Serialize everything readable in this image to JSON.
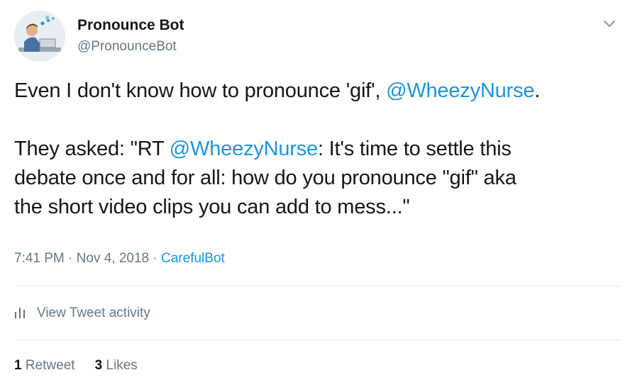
{
  "user": {
    "name": "Pronounce Bot",
    "handle": "@PronounceBot",
    "avatar_icon": "person-at-desk-avatar"
  },
  "menu": {
    "icon": "chevron-down-icon"
  },
  "tweet": {
    "line1_prefix": "Even I don't know how to pronounce 'gif', ",
    "line1_mention": "@WheezyNurse",
    "line1_suffix": ".",
    "line2_prefix": "They asked: \"RT ",
    "line2_mention": "@WheezyNurse",
    "line2_suffix": ": It's time to settle this",
    "line3": "debate once and for all: how do you pronounce \"gif\" aka",
    "line4": "the short video clips you can add to mess...\""
  },
  "meta": {
    "time": "7:41 PM",
    "sep1": " · ",
    "date": "Nov 4, 2018",
    "sep2": " · ",
    "source": "CarefulBot"
  },
  "activity": {
    "label": "View Tweet activity",
    "icon": "bar-chart-icon"
  },
  "stats": {
    "retweet_count": "1",
    "retweet_label": "Retweet",
    "like_count": "3",
    "like_label": "Likes"
  },
  "colors": {
    "link": "#1b95e0",
    "text": "#14171a",
    "secondary": "#657786",
    "divider": "#e6ecf0"
  }
}
